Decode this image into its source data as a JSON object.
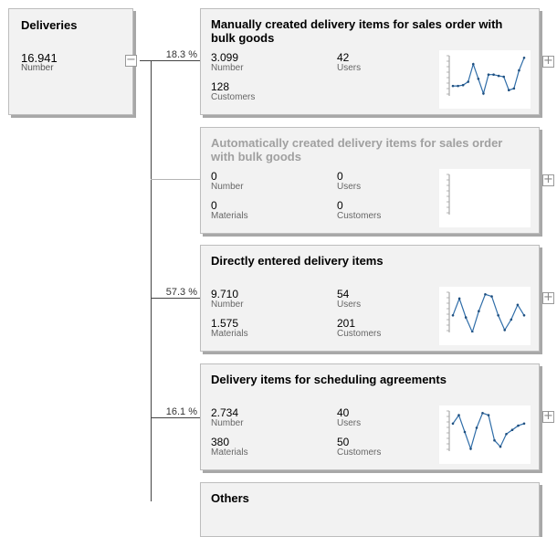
{
  "root": {
    "title": "Deliveries",
    "value": "16.941",
    "label": "Number"
  },
  "nodes": [
    {
      "title": "Manually created delivery items for sales order with bulk goods",
      "percent": "18.3 %",
      "kpis": [
        {
          "value": "3.099",
          "label": "Number"
        },
        {
          "value": "42",
          "label": "Users"
        },
        {
          "value": "128",
          "label": "Customers"
        }
      ],
      "trend": [
        0.72,
        0.72,
        0.7,
        0.62,
        0.2,
        0.55,
        0.9,
        0.45,
        0.45,
        0.48,
        0.5,
        0.82,
        0.78,
        0.35,
        0.05
      ]
    },
    {
      "title": "Automatically created delivery items for sales order with bulk goods",
      "percent": "",
      "disabled": true,
      "kpis": [
        {
          "value": "0",
          "label": "Number"
        },
        {
          "value": "0",
          "label": "Users"
        },
        {
          "value": "0",
          "label": "Materials"
        },
        {
          "value": "0",
          "label": "Customers"
        }
      ],
      "trend": []
    },
    {
      "title": "Directly entered delivery items",
      "percent": "57.3 %",
      "kpis": [
        {
          "value": "9.710",
          "label": "Number"
        },
        {
          "value": "54",
          "label": "Users"
        },
        {
          "value": "1.575",
          "label": "Materials"
        },
        {
          "value": "201",
          "label": "Customers"
        }
      ],
      "trend": [
        0.55,
        0.15,
        0.6,
        0.95,
        0.45,
        0.05,
        0.1,
        0.55,
        0.9,
        0.65,
        0.3,
        0.55
      ]
    },
    {
      "title": "Delivery items for scheduling agreements",
      "percent": "16.1 %",
      "kpis": [
        {
          "value": "2.734",
          "label": "Number"
        },
        {
          "value": "40",
          "label": "Users"
        },
        {
          "value": "380",
          "label": "Materials"
        },
        {
          "value": "50",
          "label": "Customers"
        }
      ],
      "trend": [
        0.3,
        0.1,
        0.5,
        0.9,
        0.4,
        0.05,
        0.1,
        0.7,
        0.85,
        0.55,
        0.45,
        0.35,
        0.3
      ]
    },
    {
      "title": "Others",
      "percent": "",
      "kpis": [],
      "trend": []
    }
  ],
  "toggle": {
    "collapse": "−",
    "expand": "+"
  },
  "colors": {
    "line": "#2f6da8",
    "marker": "#1f4f7f",
    "axis": "#999999"
  }
}
